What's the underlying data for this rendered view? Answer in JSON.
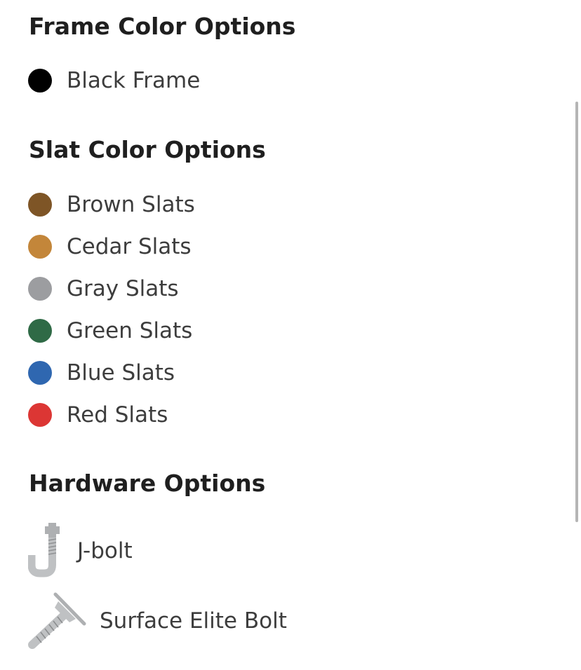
{
  "frame": {
    "title": "Frame Color Options",
    "options": [
      {
        "label": "Black Frame",
        "color": "#000000"
      }
    ]
  },
  "slats": {
    "title": "Slat Color Options",
    "options": [
      {
        "label": "Brown Slats",
        "color": "#7e5526"
      },
      {
        "label": "Cedar Slats",
        "color": "#c3863a"
      },
      {
        "label": "Gray Slats",
        "color": "#9c9da0"
      },
      {
        "label": "Green Slats",
        "color": "#2f6a46"
      },
      {
        "label": "Blue Slats",
        "color": "#2f67b0"
      },
      {
        "label": "Red Slats",
        "color": "#dc3634"
      }
    ]
  },
  "hardware": {
    "title": "Hardware Options",
    "options": [
      {
        "label": "J-bolt",
        "icon": "j-bolt-icon"
      },
      {
        "label": "Surface Elite Bolt",
        "icon": "surface-elite-bolt-icon"
      }
    ]
  }
}
